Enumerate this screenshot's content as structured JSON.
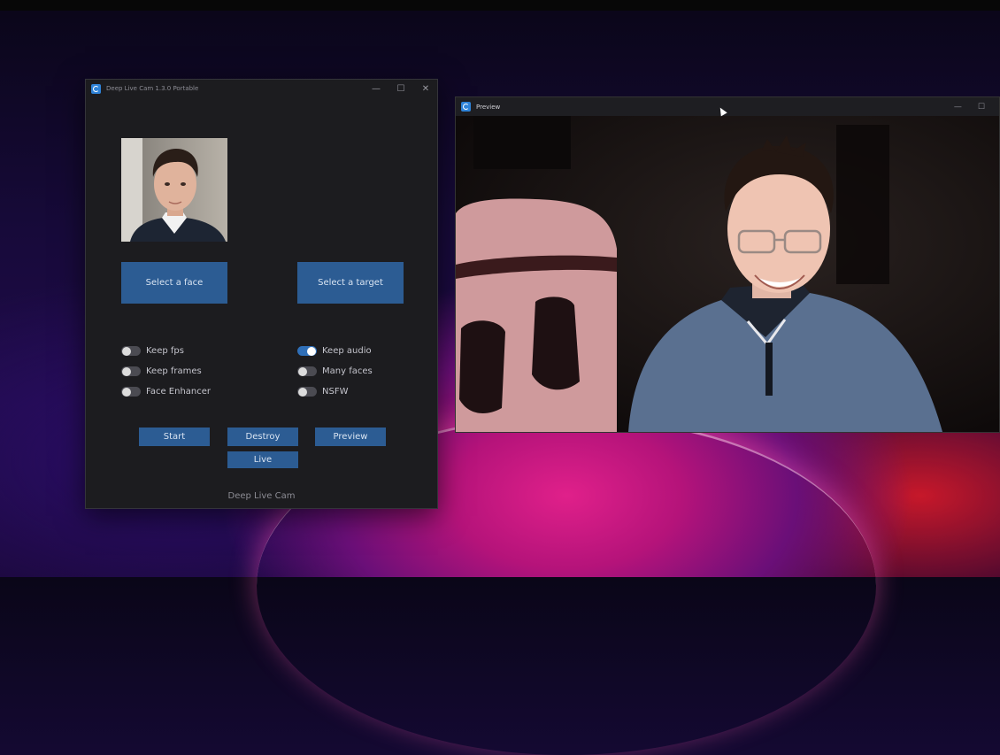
{
  "app_window": {
    "title": "Deep Live Cam 1.3.0 Portable",
    "window_buttons": [
      "—",
      "☐",
      "✕"
    ],
    "select_face_label": "Select a face",
    "select_target_label": "Select a target",
    "toggles": [
      {
        "label": "Keep fps",
        "on": false
      },
      {
        "label": "Keep frames",
        "on": false
      },
      {
        "label": "Face Enhancer",
        "on": false
      },
      {
        "label": "Keep audio",
        "on": true
      },
      {
        "label": "Many faces",
        "on": false
      },
      {
        "label": "NSFW",
        "on": false
      }
    ],
    "buttons": {
      "start": "Start",
      "destroy": "Destroy",
      "preview": "Preview",
      "live": "Live"
    },
    "footer": "Deep Live Cam",
    "accent_color": "#2c5c93"
  },
  "preview_window": {
    "title": "Preview",
    "window_buttons": [
      "—",
      "☐"
    ]
  }
}
